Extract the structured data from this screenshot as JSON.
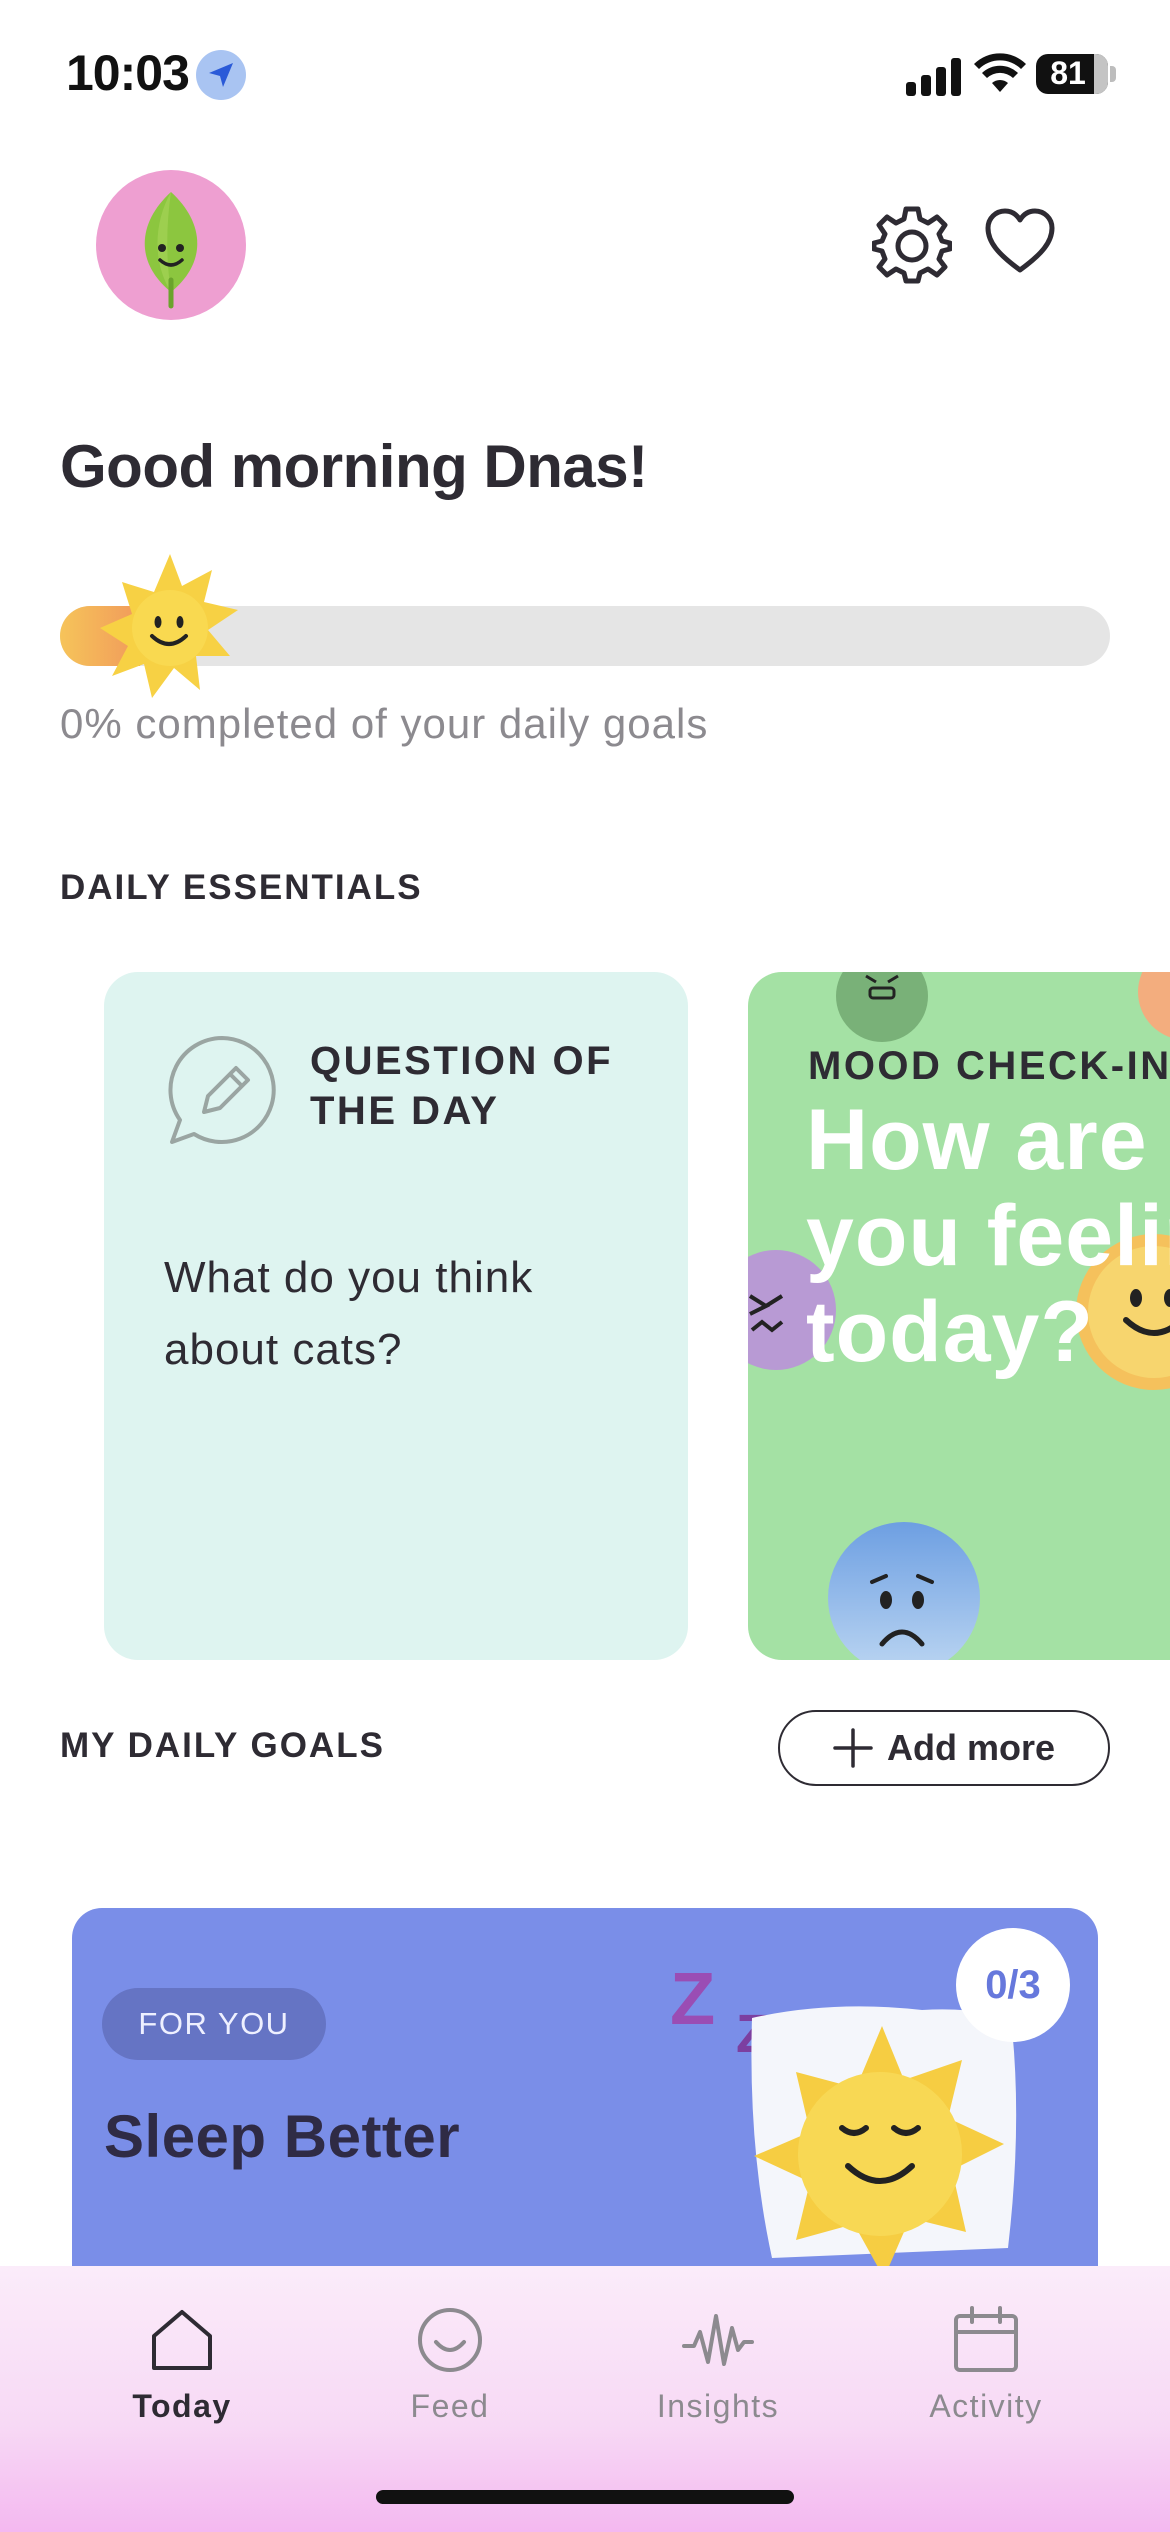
{
  "status_bar": {
    "time": "10:03",
    "battery": "81"
  },
  "header": {
    "avatar": "leaf-avatar",
    "settings_icon": "gear-icon",
    "favorites_icon": "heart-icon"
  },
  "greeting": "Good morning Dnas!",
  "progress": {
    "percent": 0,
    "caption": "0% completed of your daily goals"
  },
  "daily_essentials": {
    "title": "DAILY ESSENTIALS",
    "question_card": {
      "title": "QUESTION OF THE DAY",
      "question": "What do you think about cats?",
      "color": "#def4f0"
    },
    "mood_card": {
      "kicker": "MOOD CHECK-IN",
      "prompt": "How are you feeling today?",
      "color": "#a4e1a4"
    }
  },
  "daily_goals": {
    "title": "MY DAILY GOALS",
    "add_label": "Add more",
    "goal": {
      "tag": "FOR YOU",
      "title": "Sleep Better",
      "count": "0/3",
      "color": "#7a8ee8"
    }
  },
  "tabs": [
    {
      "label": "Today",
      "icon": "home-icon",
      "active": true
    },
    {
      "label": "Feed",
      "icon": "smile-icon",
      "active": false
    },
    {
      "label": "Insights",
      "icon": "waveform-icon",
      "active": false
    },
    {
      "label": "Activity",
      "icon": "calendar-icon",
      "active": false
    }
  ]
}
